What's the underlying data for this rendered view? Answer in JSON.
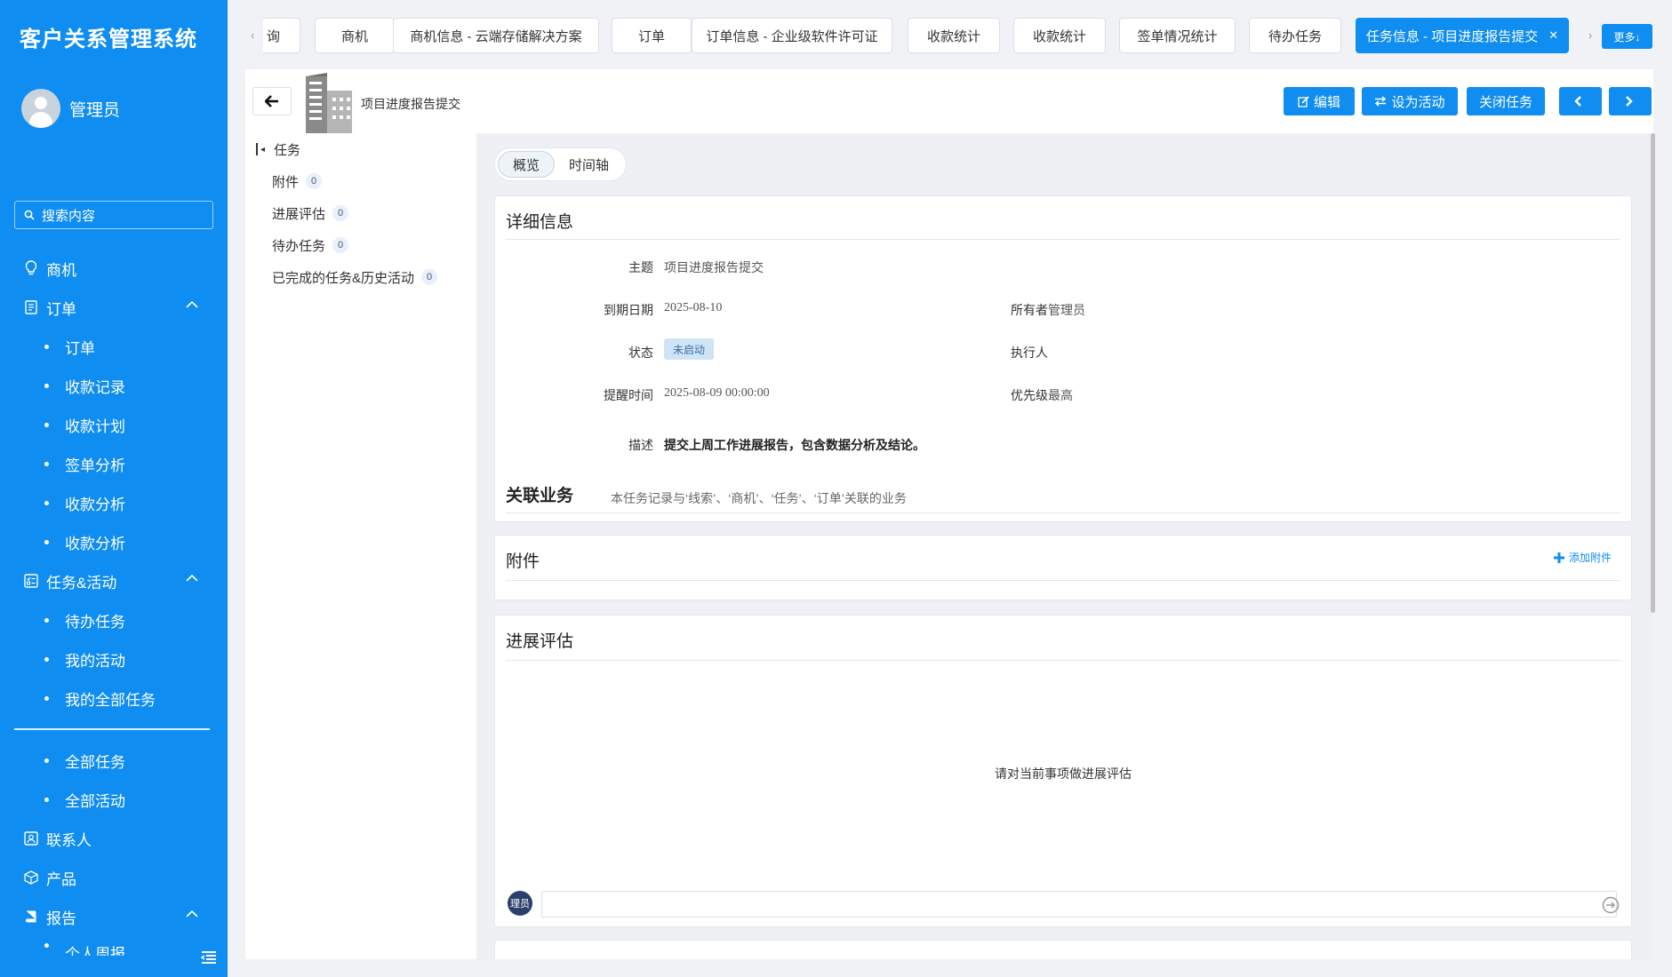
{
  "app": {
    "title": "客户关系管理系统"
  },
  "user": {
    "name": "管理员"
  },
  "search": {
    "placeholder": "搜索内容"
  },
  "sidebar": {
    "items": [
      {
        "label": "商机",
        "icon": "lightbulb-icon"
      },
      {
        "label": "订单",
        "icon": "document-icon",
        "expanded": true,
        "children": [
          "订单",
          "收款记录",
          "收款计划",
          "签单分析",
          "收款分析",
          "收款分析"
        ]
      },
      {
        "label": "任务&活动",
        "icon": "task-list-icon",
        "expanded": true,
        "children": [
          "待办任务",
          "我的活动",
          "我的全部任务"
        ],
        "children2": [
          "全部任务",
          "全部活动"
        ]
      },
      {
        "label": "联系人",
        "icon": "contact-card-icon"
      },
      {
        "label": "产品",
        "icon": "box-icon"
      },
      {
        "label": "报告",
        "icon": "book-icon",
        "expanded": true,
        "children": [
          "个人周报"
        ]
      }
    ]
  },
  "tabs": [
    {
      "label": "询"
    },
    {
      "label": "商机"
    },
    {
      "label": "商机信息 - 云端存储解决方案"
    },
    {
      "label": "订单"
    },
    {
      "label": "订单信息 - 企业级软件许可证"
    },
    {
      "label": "收款统计"
    },
    {
      "label": "收款统计"
    },
    {
      "label": "签单情况统计"
    },
    {
      "label": "待办任务"
    },
    {
      "label": "任务信息 - 项目进度报告提交",
      "active": true
    }
  ],
  "more_label": "更多↓",
  "header": {
    "title": "项目进度报告提交"
  },
  "actions": {
    "edit": "编辑",
    "set_active": "设为活动",
    "close_task": "关闭任务"
  },
  "left_nav": [
    {
      "label": "任务"
    },
    {
      "label": "附件",
      "count": "0"
    },
    {
      "label": "进展评估",
      "count": "0"
    },
    {
      "label": "待办任务",
      "count": "0"
    },
    {
      "label": "已完成的任务&历史活动",
      "count": "0"
    }
  ],
  "view_tabs": {
    "overview": "概览",
    "timeline": "时间轴"
  },
  "details": {
    "title": "详细信息",
    "subject_label": "主题",
    "subject": "项目进度报告提交",
    "due_label": "到期日期",
    "due": "2025-08-10",
    "owner_label": "所有者",
    "owner": "管理员",
    "status_label": "状态",
    "status": "未启动",
    "executor_label": "执行人",
    "remind_label": "提醒时间",
    "remind": "2025-08-09 00:00:00",
    "priority_label": "优先级",
    "priority": "最高",
    "desc_label": "描述",
    "desc": "提交上周工作进展报告，包含数据分析及结论。",
    "related_title": "关联业务",
    "related_note": "本任务记录与‘线索’、‘商机’、‘任务’、‘订单’关联的业务"
  },
  "attachments": {
    "title": "附件",
    "add_label": "添加附件"
  },
  "evaluation": {
    "title": "进展评估",
    "hint": "请对当前事项做进展评估",
    "avatar_text": "理员"
  },
  "colors": {
    "primary": "#0f8df0",
    "status_tag_bg": "#cfe4f7"
  }
}
